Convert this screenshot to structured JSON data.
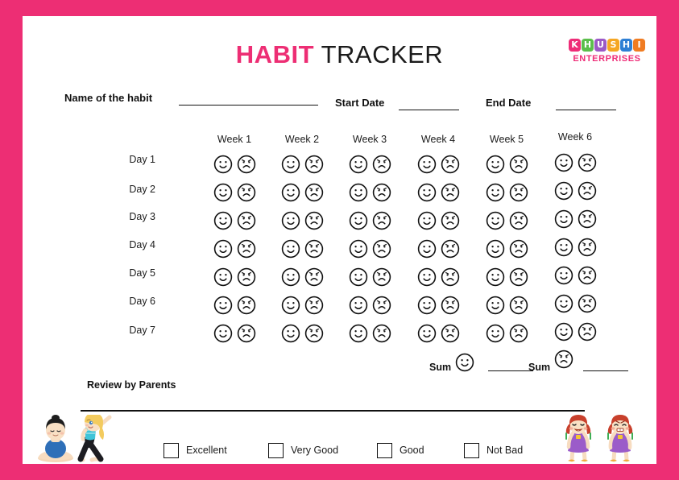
{
  "page": {
    "border_color": "#ED2E74",
    "background": "#ffffff"
  },
  "header": {
    "title_part1": "HABIT",
    "title_part2": " TRACKER",
    "title_color_1": "#ED2E74",
    "title_color_2": "#1b1b1b"
  },
  "logo": {
    "letters": [
      {
        "ch": "K",
        "color": "#EE2D78"
      },
      {
        "ch": "H",
        "color": "#5BBE4B"
      },
      {
        "ch": "U",
        "color": "#9B59C6"
      },
      {
        "ch": "S",
        "color": "#F5A623"
      },
      {
        "ch": "H",
        "color": "#2E7FD4"
      },
      {
        "ch": "I",
        "color": "#F07C22"
      }
    ],
    "subtitle": "ENTERPRISES",
    "subtitle_color": "#EE2D78"
  },
  "form": {
    "habit_label": "Name of the habit",
    "start_date_label": "Start Date",
    "end_date_label": "End Date"
  },
  "tracker": {
    "weeks": [
      "Week 1",
      "Week 2",
      "Week 3",
      "Week 4",
      "Week 5",
      "Week 6"
    ],
    "days": [
      "Day 1",
      "Day 2",
      "Day 3",
      "Day 4",
      "Day 5",
      "Day 6",
      "Day 7"
    ],
    "face_options": [
      "happy",
      "sad"
    ]
  },
  "sum_row": {
    "happy_label": "Sum",
    "happy_icon": "happy-face-icon",
    "sad_label": "Sum",
    "sad_icon": "sad-face-icon"
  },
  "review": {
    "label": "Review by Parents"
  },
  "ratings": [
    {
      "label": "Excellent"
    },
    {
      "label": "Very Good"
    },
    {
      "label": "Good"
    },
    {
      "label": "Not Bad"
    }
  ],
  "illustrations": {
    "left": "two-yoga-kids-illustration",
    "right": "two-girls-happy-sad-illustration"
  }
}
